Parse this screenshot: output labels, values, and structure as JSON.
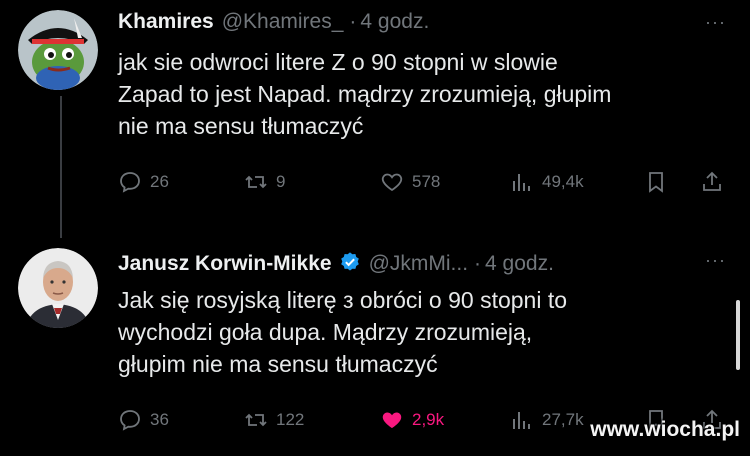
{
  "tweets": [
    {
      "name": "Khamires",
      "handle": "@Khamires_",
      "separator": "·",
      "time": "4 godz.",
      "more": "···",
      "text_lines": [
        "jak sie odwroci litere Z o 90 stopni w slowie",
        "Zapad to jest Napad. mądrzy zrozumieją, głupim",
        "nie ma sensu tłumaczyć"
      ],
      "replies": "26",
      "reposts": "9",
      "likes": "578",
      "views": "49,4k",
      "liked": false,
      "avatar_icon": "frog-avatar-icon"
    },
    {
      "name": "Janusz Korwin-Mikke",
      "handle": "@JkmMi...",
      "separator": "·",
      "time": "4 godz.",
      "more": "···",
      "verified": true,
      "text_lines": [
        "Jak się rosyjską literę з obróci o 90 stopni to",
        "wychodzi goła dupa. Mądrzy zrozumieją,",
        "głupim nie ma sensu tłumaczyć"
      ],
      "replies": "36",
      "reposts": "122",
      "likes": "2,9k",
      "views": "27,7k",
      "liked": true,
      "avatar_icon": "person-avatar-icon"
    }
  ],
  "watermark": "www.wiocha.pl",
  "colors": {
    "background": "#000000",
    "text": "#e7e9ea",
    "muted": "#71767b",
    "like_active": "#f91880",
    "verified": "#1d9bf0"
  }
}
